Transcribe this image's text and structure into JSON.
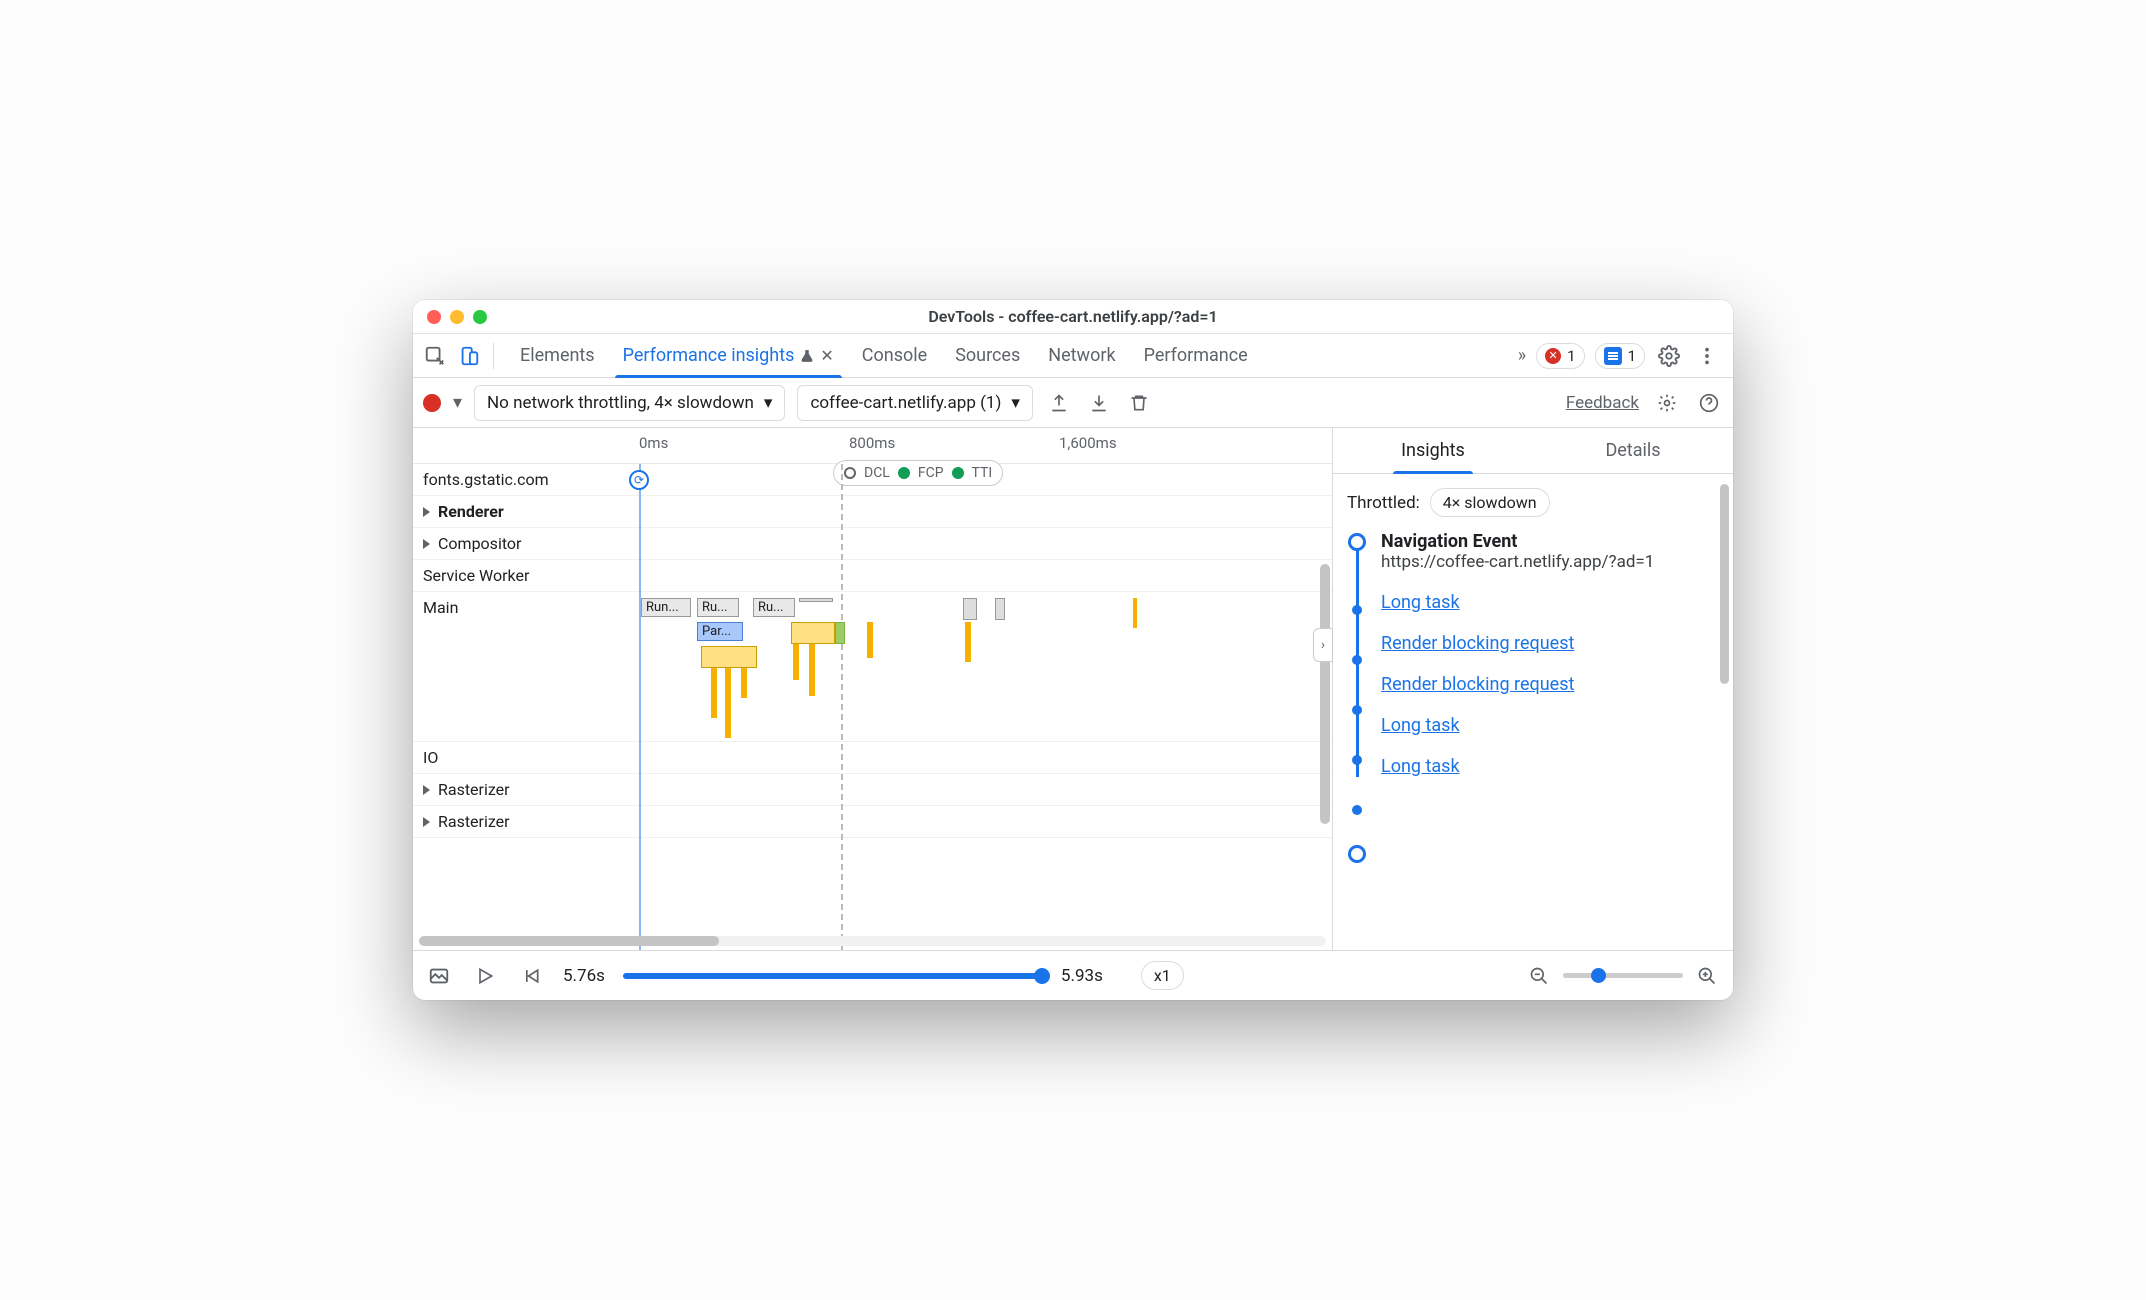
{
  "window_title": "DevTools - coffee-cart.netlify.app/?ad=1",
  "tabs": [
    "Elements",
    "Performance insights",
    "Console",
    "Sources",
    "Network",
    "Performance"
  ],
  "active_tab": "Performance insights",
  "overflow_glyph": "»",
  "error_count": "1",
  "info_count": "1",
  "toolbar": {
    "throttle_label": "No network throttling, 4× slowdown",
    "target_label": "coffee-cart.netlify.app (1)",
    "feedback": "Feedback"
  },
  "ruler": {
    "t0": "0ms",
    "t1": "800ms",
    "t2": "1,600ms"
  },
  "markers": {
    "dcl": "DCL",
    "fcp": "FCP",
    "tti": "TTI"
  },
  "rows": {
    "fonts": "fonts.gstatic.com",
    "renderer": "Renderer",
    "compositor": "Compositor",
    "service_worker": "Service Worker",
    "main": "Main",
    "io": "IO",
    "rasterizer": "Rasterizer",
    "rasterizer2": "Rasterizer"
  },
  "flame": {
    "run": "Run...",
    "run2": "Ru...",
    "run3": "Ru...",
    "parse": "Par..."
  },
  "side": {
    "tab_insights": "Insights",
    "tab_details": "Details",
    "throttled_label": "Throttled:",
    "throttled_value": "4× slowdown",
    "nav_title": "Navigation Event",
    "nav_url": "https://coffee-cart.netlify.app/?ad=1",
    "steps": [
      "Long task",
      "Render blocking request",
      "Render blocking request",
      "Long task",
      "Long task"
    ]
  },
  "footer": {
    "t_start": "5.76s",
    "t_end": "5.93s",
    "speed": "x1"
  }
}
